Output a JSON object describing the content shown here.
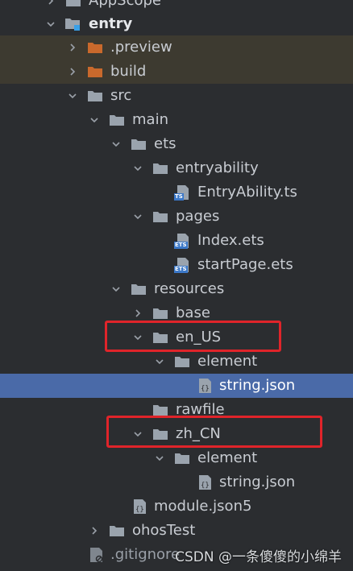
{
  "tree": {
    "appscope_label": "AppScope",
    "entry_label": "entry",
    "preview_label": ".preview",
    "build_label": "build",
    "src_label": "src",
    "main_label": "main",
    "ets_label": "ets",
    "entryability_label": "entryability",
    "entryability_ts_label": "EntryAbility.ts",
    "pages_label": "pages",
    "index_ets_label": "Index.ets",
    "startpage_ets_label": "startPage.ets",
    "resources_label": "resources",
    "base_label": "base",
    "en_us_label": "en_US",
    "en_element_label": "element",
    "en_string_json_label": "string.json",
    "rawfile_label": "rawfile",
    "zh_cn_label": "zh_CN",
    "zh_element_label": "element",
    "zh_string_json_label": "string.json",
    "module_json5_label": "module.json5",
    "ohostest_label": "ohosTest",
    "gitignore_label": ".gitignore"
  },
  "file_badges": {
    "ts": "TS",
    "ets": "ETS"
  },
  "watermark": "CSDN @一条傻傻的小绵羊",
  "colors": {
    "background": "#2b2d30",
    "selected_row": "#4a6aa8",
    "excluded_row": "#3d3a30",
    "excluded_folder": "#c9692c",
    "folder": "#9aa3ad",
    "highlight_box": "#e0242a"
  }
}
